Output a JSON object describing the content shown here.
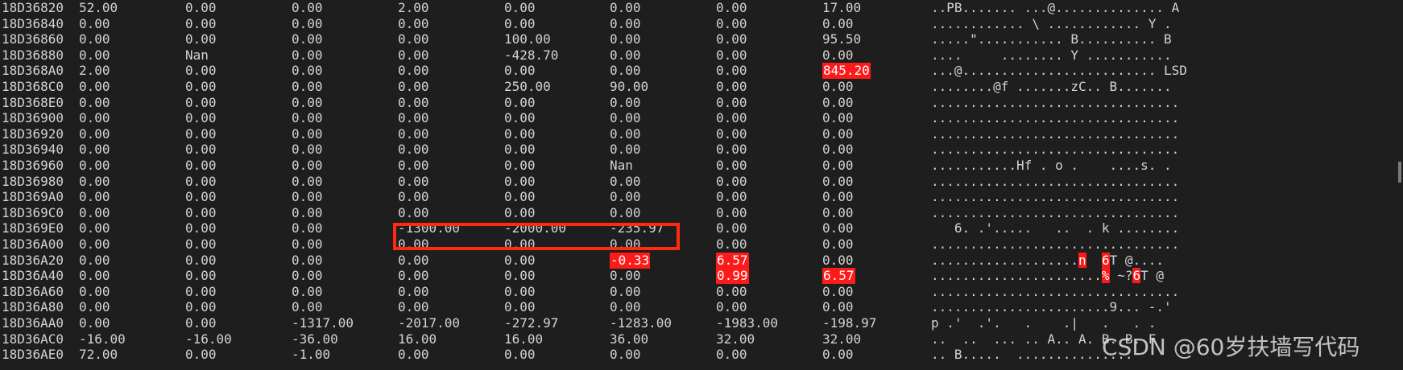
{
  "colors": {
    "background": "#1e1e1e",
    "text": "#d4d4d4",
    "highlight": "#ff1a1a",
    "box": "#ff2a10"
  },
  "rows": [
    {
      "addr": "18D36820",
      "vals": [
        "52.00",
        "0.00",
        "0.00",
        "2.00",
        "0.00",
        "0.00",
        "0.00",
        "17.00"
      ],
      "ascii": "..PB....... ...@.............. A"
    },
    {
      "addr": "18D36840",
      "vals": [
        "0.00",
        "0.00",
        "0.00",
        "0.00",
        "0.00",
        "0.00",
        "0.00",
        "0.00"
      ],
      "ascii": "............ \\ ............ Y ."
    },
    {
      "addr": "18D36860",
      "vals": [
        "0.00",
        "0.00",
        "0.00",
        "0.00",
        "100.00",
        "0.00",
        "0.00",
        "95.50"
      ],
      "ascii": ".....\"........... B.......... B"
    },
    {
      "addr": "18D36880",
      "vals": [
        "0.00",
        "Nan",
        "0.00",
        "0.00",
        "-428.70",
        "0.00",
        "0.00",
        "0.00"
      ],
      "ascii": "....     ........ Y ..........."
    },
    {
      "addr": "18D368A0",
      "vals": [
        "2.00",
        "0.00",
        "0.00",
        "0.00",
        "0.00",
        "0.00",
        "0.00",
        "845.20"
      ],
      "ascii": "...@......................... LSD"
    },
    {
      "addr": "18D368C0",
      "vals": [
        "0.00",
        "0.00",
        "0.00",
        "0.00",
        "250.00",
        "90.00",
        "0.00",
        "0.00"
      ],
      "ascii": "........@f .......zC.. B......."
    },
    {
      "addr": "18D368E0",
      "vals": [
        "0.00",
        "0.00",
        "0.00",
        "0.00",
        "0.00",
        "0.00",
        "0.00",
        "0.00"
      ],
      "ascii": "................................"
    },
    {
      "addr": "18D36900",
      "vals": [
        "0.00",
        "0.00",
        "0.00",
        "0.00",
        "0.00",
        "0.00",
        "0.00",
        "0.00"
      ],
      "ascii": "................................"
    },
    {
      "addr": "18D36920",
      "vals": [
        "0.00",
        "0.00",
        "0.00",
        "0.00",
        "0.00",
        "0.00",
        "0.00",
        "0.00"
      ],
      "ascii": "................................"
    },
    {
      "addr": "18D36940",
      "vals": [
        "0.00",
        "0.00",
        "0.00",
        "0.00",
        "0.00",
        "0.00",
        "0.00",
        "0.00"
      ],
      "ascii": "................................"
    },
    {
      "addr": "18D36960",
      "vals": [
        "0.00",
        "0.00",
        "0.00",
        "0.00",
        "0.00",
        "Nan",
        "0.00",
        "0.00"
      ],
      "ascii": "...........Hf . o .    ....s. ."
    },
    {
      "addr": "18D36980",
      "vals": [
        "0.00",
        "0.00",
        "0.00",
        "0.00",
        "0.00",
        "0.00",
        "0.00",
        "0.00"
      ],
      "ascii": "................................"
    },
    {
      "addr": "18D369A0",
      "vals": [
        "0.00",
        "0.00",
        "0.00",
        "0.00",
        "0.00",
        "0.00",
        "0.00",
        "0.00"
      ],
      "ascii": "................................"
    },
    {
      "addr": "18D369C0",
      "vals": [
        "0.00",
        "0.00",
        "0.00",
        "0.00",
        "0.00",
        "0.00",
        "0.00",
        "0.00"
      ],
      "ascii": "................................"
    },
    {
      "addr": "18D369E0",
      "vals": [
        "0.00",
        "0.00",
        "0.00",
        "-1300.00",
        "-2000.00",
        "-235.97",
        "0.00",
        "0.00"
      ],
      "ascii": "   6. .'.....   ..  . k ........"
    },
    {
      "addr": "18D36A00",
      "vals": [
        "0.00",
        "0.00",
        "0.00",
        "0.00",
        "0.00",
        "0.00",
        "0.00",
        "0.00"
      ],
      "ascii": "................................"
    },
    {
      "addr": "18D36A20",
      "vals": [
        "0.00",
        "0.00",
        "0.00",
        "0.00",
        "0.00",
        "-0.33",
        "6.57",
        "0.00"
      ],
      "ascii": "...................n  6T @...."
    },
    {
      "addr": "18D36A40",
      "vals": [
        "0.00",
        "0.00",
        "0.00",
        "0.00",
        "0.00",
        "0.00",
        "0.99",
        "6.57"
      ],
      "ascii": "......................% ~?6T @"
    },
    {
      "addr": "18D36A60",
      "vals": [
        "0.00",
        "0.00",
        "0.00",
        "0.00",
        "0.00",
        "0.00",
        "0.00",
        "0.00"
      ],
      "ascii": "................................"
    },
    {
      "addr": "18D36A80",
      "vals": [
        "0.00",
        "0.00",
        "0.00",
        "0.00",
        "0.00",
        "0.00",
        "0.00",
        "0.00"
      ],
      "ascii": ".......................9... -.'"
    },
    {
      "addr": "18D36AA0",
      "vals": [
        "0.00",
        "0.00",
        "-1317.00",
        "-2017.00",
        "-272.97",
        "-1283.00",
        "-1983.00",
        "-198.97"
      ],
      "ascii": "p .'  .'.   .    .|   .   . .  "
    },
    {
      "addr": "18D36AC0",
      "vals": [
        "-16.00",
        "-16.00",
        "-36.00",
        "16.00",
        "16.00",
        "36.00",
        "32.00",
        "32.00"
      ],
      "ascii": "..  ..  ... .. A.. A. B. B. F  "
    },
    {
      "addr": "18D36AE0",
      "vals": [
        "72.00",
        "0.00",
        "-1.00",
        "0.00",
        "0.00",
        "0.00",
        "0.00",
        "0.00"
      ],
      "ascii": ".. B.....  ..............."
    }
  ],
  "highlights": [
    {
      "row": 4,
      "col": 7
    },
    {
      "row": 16,
      "col": 5
    },
    {
      "row": 16,
      "col": 6
    },
    {
      "row": 17,
      "col": 6
    },
    {
      "row": 17,
      "col": 7
    }
  ],
  "ascii_highlights": [
    {
      "row": 16,
      "chars": [
        "n",
        "6"
      ]
    },
    {
      "row": 17,
      "chars": [
        "%",
        "6"
      ]
    }
  ],
  "watermark": "CSDN @60岁扶墙写代码"
}
